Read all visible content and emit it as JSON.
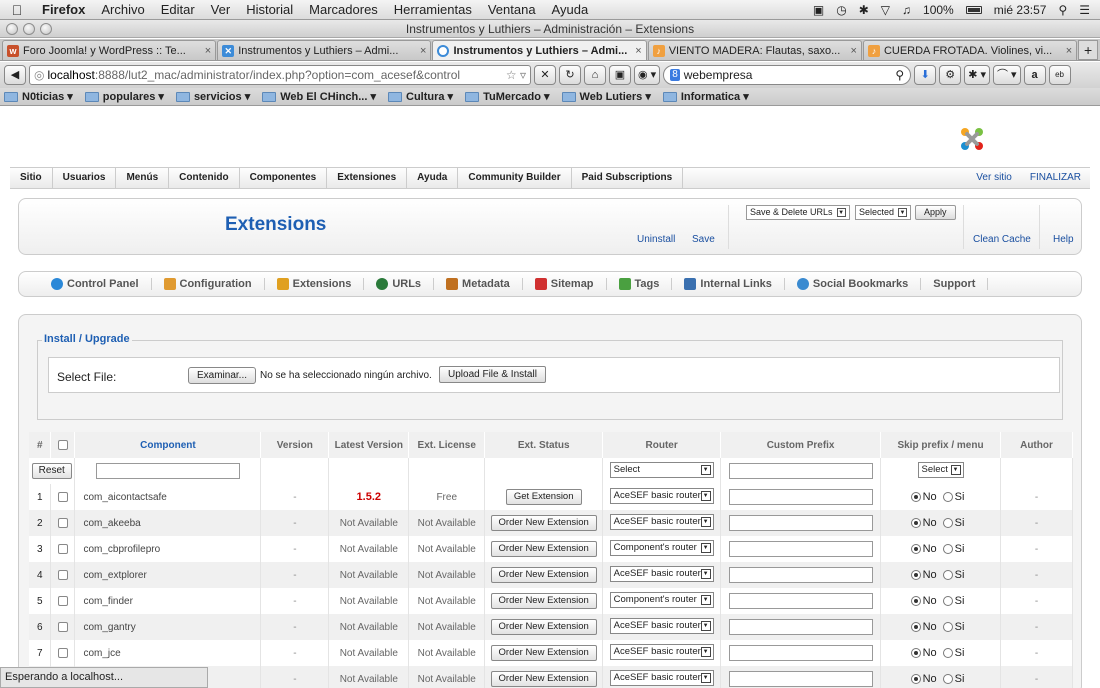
{
  "mac_menu": {
    "app": "Firefox",
    "items": [
      "Archivo",
      "Editar",
      "Ver",
      "Historial",
      "Marcadores",
      "Herramientas",
      "Ventana",
      "Ayuda"
    ],
    "battery": "100%",
    "clock": "mié 23:57"
  },
  "window": {
    "title": "Instrumentos y Luthiers – Administración – Extensions"
  },
  "tabs": [
    {
      "label": "Foro Joomla! y WordPress :: Te...",
      "icon": "joomla-forum-favicon",
      "color": "#c8502b"
    },
    {
      "label": "Instrumentos y Luthiers – Admi...",
      "icon": "joomla-favicon",
      "color": "#3c8bd8"
    },
    {
      "label": "Instrumentos y Luthiers – Admi...",
      "icon": "loading-icon",
      "color": "#3c8bd8"
    },
    {
      "label": "VIENTO MADERA: Flautas, saxo...",
      "icon": "site-favicon",
      "color": "#f0a040"
    },
    {
      "label": "CUERDA FROTADA. Violines, vi...",
      "icon": "site-favicon",
      "color": "#f0a040"
    }
  ],
  "nav": {
    "url_host": "localhost",
    "url_path": ":8888/lut2_mac/administrator/index.php?option=com_acesef&control",
    "search_value": "webempresa"
  },
  "bookmarks": [
    "N0ticias",
    "populares",
    "servicios",
    "Web El CHinch...",
    "Cultura",
    "TuMercado",
    "Web Lutiers",
    "Informatica"
  ],
  "admin_menu": {
    "items": [
      "Sitio",
      "Usuarios",
      "Menús",
      "Contenido",
      "Componentes",
      "Extensiones",
      "Ayuda",
      "Community Builder",
      "Paid Subscriptions"
    ],
    "view_site": "Ver sitio",
    "logout": "FINALIZAR"
  },
  "toolbar": {
    "title": "Extensions",
    "uninstall": "Uninstall",
    "save": "Save",
    "select_urls": "Save & Delete URLs",
    "select_scope": "Selected",
    "apply": "Apply",
    "clean_cache": "Clean Cache",
    "help": "Help"
  },
  "subnav": [
    {
      "label": "Control Panel",
      "icon": "control-panel-icon",
      "color": "#2a88d8"
    },
    {
      "label": "Configuration",
      "icon": "tools-icon",
      "color": "#e09a30"
    },
    {
      "label": "Extensions",
      "icon": "extensions-icon",
      "color": "#e0a020"
    },
    {
      "label": "URLs",
      "icon": "globe-icon",
      "color": "#2a7a3a"
    },
    {
      "label": "Metadata",
      "icon": "metadata-icon",
      "color": "#c07020"
    },
    {
      "label": "Sitemap",
      "icon": "sitemap-icon",
      "color": "#d03030"
    },
    {
      "label": "Tags",
      "icon": "tags-icon",
      "color": "#4aa040"
    },
    {
      "label": "Internal Links",
      "icon": "internal-links-icon",
      "color": "#3a70b0"
    },
    {
      "label": "Social Bookmarks",
      "icon": "social-bookmarks-icon",
      "color": "#3a8ad0"
    },
    {
      "label": "Support",
      "icon": "",
      "color": ""
    }
  ],
  "install": {
    "legend": "Install / Upgrade",
    "select_label": "Select File:",
    "browse": "Examinar...",
    "no_file": "No se ha seleccionado ningún archivo.",
    "upload": "Upload File & Install"
  },
  "table": {
    "headers": [
      "#",
      "",
      "Component",
      "Version",
      "Latest Version",
      "Ext. License",
      "Ext. Status",
      "Router",
      "Custom Prefix",
      "Skip prefix / menu",
      "Author"
    ],
    "filter": {
      "reset": "Reset",
      "router_select": "Select",
      "skip_select": "Select"
    },
    "radio_no": "No",
    "radio_si": "Si",
    "rows": [
      {
        "num": "1",
        "component": "com_aicontactsafe",
        "version": "-",
        "latest": "1.5.2",
        "license": "Free",
        "status": "Get Extension",
        "router": "AceSEF basic router",
        "author": "-"
      },
      {
        "num": "2",
        "component": "com_akeeba",
        "version": "-",
        "latest": "Not Available",
        "license": "Not Available",
        "status": "Order New Extension",
        "router": "AceSEF basic router",
        "author": "-"
      },
      {
        "num": "3",
        "component": "com_cbprofilepro",
        "version": "-",
        "latest": "Not Available",
        "license": "Not Available",
        "status": "Order New Extension",
        "router": "Component's router",
        "author": "-"
      },
      {
        "num": "4",
        "component": "com_extplorer",
        "version": "-",
        "latest": "Not Available",
        "license": "Not Available",
        "status": "Order New Extension",
        "router": "AceSEF basic router",
        "author": "-"
      },
      {
        "num": "5",
        "component": "com_finder",
        "version": "-",
        "latest": "Not Available",
        "license": "Not Available",
        "status": "Order New Extension",
        "router": "Component's router",
        "author": "-"
      },
      {
        "num": "6",
        "component": "com_gantry",
        "version": "-",
        "latest": "Not Available",
        "license": "Not Available",
        "status": "Order New Extension",
        "router": "AceSEF basic router",
        "author": "-"
      },
      {
        "num": "7",
        "component": "com_jce",
        "version": "-",
        "latest": "Not Available",
        "license": "Not Available",
        "status": "Order New Extension",
        "router": "AceSEF basic router",
        "author": "-"
      },
      {
        "num": "",
        "component": "",
        "version": "-",
        "latest": "Not Available",
        "license": "Not Available",
        "status": "Order New Extension",
        "router": "AceSEF basic router",
        "author": "-"
      }
    ]
  },
  "status_bar": "Esperando a localhost..."
}
